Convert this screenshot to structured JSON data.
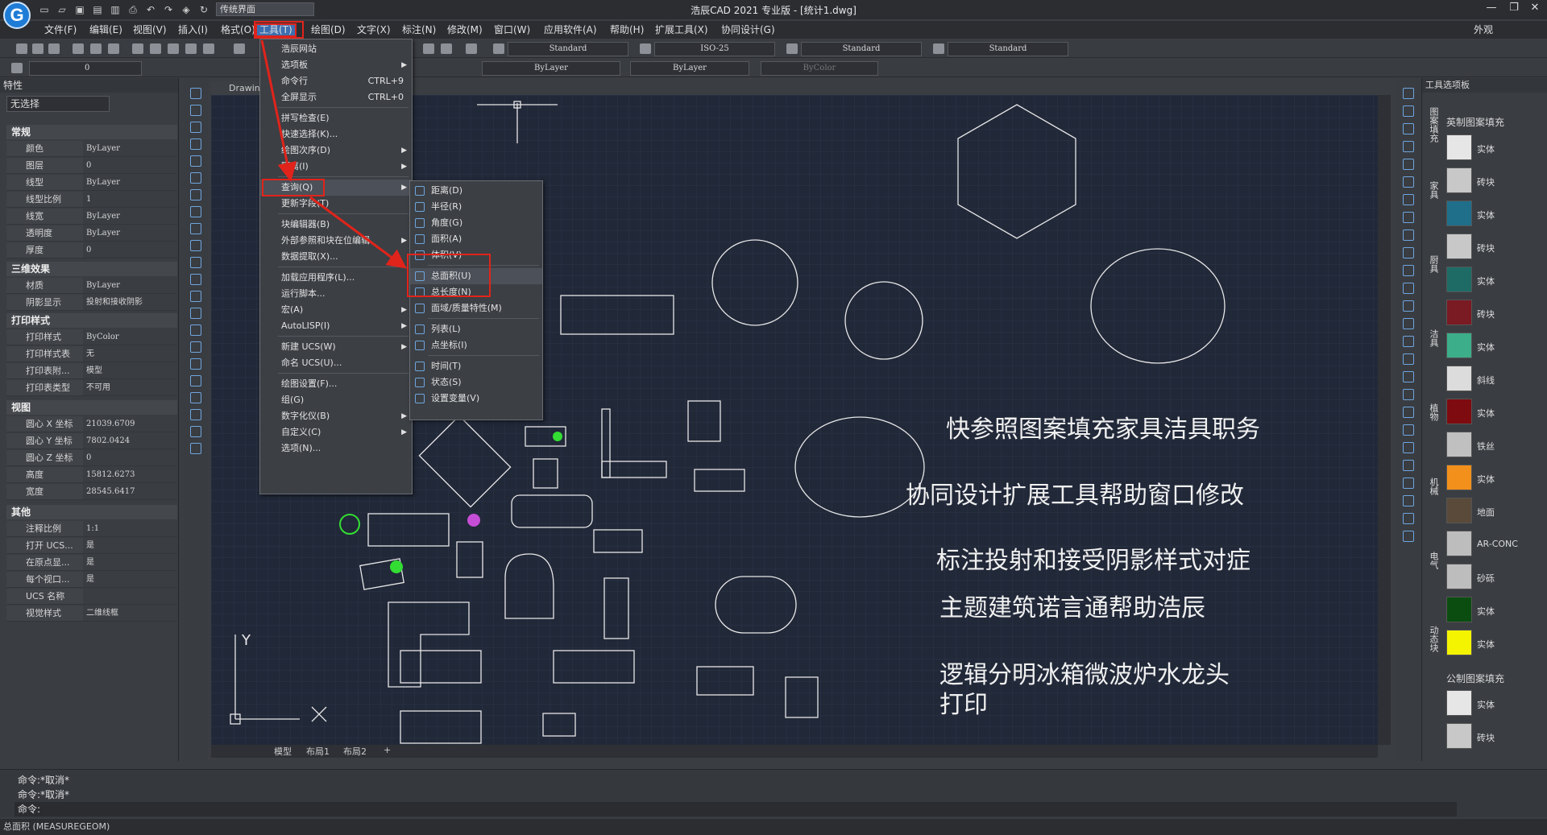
{
  "app_title": "浩辰CAD 2021 专业版 - [统计1.dwg]",
  "workspace": "传统界面",
  "appearance": "外观",
  "menus": [
    "文件(F)",
    "编辑(E)",
    "视图(V)",
    "插入(I)",
    "格式(O)",
    "工具(T)",
    "绘图(D)",
    "文字(X)",
    "标注(N)",
    "修改(M)",
    "窗口(W)",
    "应用软件(A)",
    "帮助(H)",
    "扩展工具(X)",
    "协同设计(G)"
  ],
  "toolbar_dropdowns": {
    "text_style": "Standard",
    "dim_style": "ISO-25",
    "table_style": "Standard",
    "mleader_style": "Standard",
    "layer_value": "0",
    "linetype": "ByLayer",
    "lineweight": "ByLayer",
    "color": "ByColor"
  },
  "properties": {
    "title": "特性",
    "selection": "无选择",
    "sections": {
      "general": {
        "title": "常规",
        "rows": [
          [
            "颜色",
            "ByLayer"
          ],
          [
            "图层",
            "0"
          ],
          [
            "线型",
            "ByLayer"
          ],
          [
            "线型比例",
            "1"
          ],
          [
            "线宽",
            "ByLayer"
          ],
          [
            "透明度",
            "ByLayer"
          ],
          [
            "厚度",
            "0"
          ]
        ]
      },
      "effects": {
        "title": "三维效果",
        "rows": [
          [
            "材质",
            "ByLayer"
          ],
          [
            "阴影显示",
            "投射和接收阴影"
          ]
        ]
      },
      "print": {
        "title": "打印样式",
        "rows": [
          [
            "打印样式",
            "ByColor"
          ],
          [
            "打印样式表",
            "无"
          ],
          [
            "打印表附...",
            "模型"
          ],
          [
            "打印表类型",
            "不可用"
          ]
        ]
      },
      "view": {
        "title": "视图",
        "rows": [
          [
            "圆心 X 坐标",
            "21039.6709"
          ],
          [
            "圆心 Y 坐标",
            "7802.0424"
          ],
          [
            "圆心 Z 坐标",
            "0"
          ],
          [
            "高度",
            "15812.6273"
          ],
          [
            "宽度",
            "28545.6417"
          ]
        ]
      },
      "misc": {
        "title": "其他",
        "rows": [
          [
            "注释比例",
            "1:1"
          ],
          [
            "打开 UCS...",
            "是"
          ],
          [
            "在原点显...",
            "是"
          ],
          [
            "每个视口...",
            "是"
          ],
          [
            "UCS 名称",
            ""
          ],
          [
            "视觉样式",
            "二维线框"
          ]
        ]
      }
    }
  },
  "canvas_tab": "Drawin",
  "layout_tabs": [
    "模型",
    "布局1",
    "布局2",
    "+"
  ],
  "canvas_text": [
    "快参照图案填充家具洁具职务",
    "协同设计扩展工具帮助窗口修改",
    "标注投射和接受阴影样式对症",
    "主题建筑诺言通帮助浩辰",
    "逻辑分明冰箱微波炉水龙头",
    "打印"
  ],
  "axis": {
    "y": "Y",
    "x": "X"
  },
  "tools_menu": [
    {
      "label": "浩辰网站"
    },
    {
      "label": "选项板",
      "arrow": true
    },
    {
      "label": "命令行",
      "shortcut": "CTRL+9"
    },
    {
      "label": "全屏显示",
      "shortcut": "CTRL+0"
    },
    {
      "label": "拼写检查(E)"
    },
    {
      "label": "快速选择(K)..."
    },
    {
      "label": "绘图次序(D)",
      "arrow": true
    },
    {
      "label": "隔离(I)",
      "arrow": true
    },
    {
      "label": "查询(Q)",
      "arrow": true
    },
    {
      "label": "更新字段(T)"
    },
    {
      "label": "块编辑器(B)"
    },
    {
      "label": "外部参照和块在位编辑",
      "arrow": true
    },
    {
      "label": "数据提取(X)..."
    },
    {
      "label": "加载应用程序(L)..."
    },
    {
      "label": "运行脚本..."
    },
    {
      "label": "宏(A)",
      "arrow": true
    },
    {
      "label": "AutoLISP(I)",
      "arrow": true
    },
    {
      "label": "新建 UCS(W)",
      "arrow": true
    },
    {
      "label": "命名 UCS(U)..."
    },
    {
      "label": "绘图设置(F)..."
    },
    {
      "label": "组(G)"
    },
    {
      "label": "数字化仪(B)",
      "arrow": true
    },
    {
      "label": "自定义(C)",
      "arrow": true
    },
    {
      "label": "选项(N)..."
    }
  ],
  "query_menu": [
    {
      "label": "距离(D)"
    },
    {
      "label": "半径(R)"
    },
    {
      "label": "角度(G)"
    },
    {
      "label": "面积(A)"
    },
    {
      "label": "体积(V)"
    },
    {
      "label": "总面积(U)"
    },
    {
      "label": "总长度(N)"
    },
    {
      "label": "面域/质量特性(M)"
    },
    {
      "label": "列表(L)"
    },
    {
      "label": "点坐标(I)"
    },
    {
      "label": "时间(T)"
    },
    {
      "label": "状态(S)"
    },
    {
      "label": "设置变量(V)"
    }
  ],
  "palette": {
    "title": "工具选项板",
    "imperial_title": "英制图案填充",
    "metric_title": "公制图案填充",
    "imperial": [
      [
        "实体",
        "#e6e6e6"
      ],
      [
        "砖块",
        "#c8c8c8"
      ],
      [
        "实体",
        "#1f6f8b"
      ],
      [
        "砖块",
        "#c8c8c8"
      ],
      [
        "实体",
        "#1e6b66"
      ],
      [
        "砖块",
        "#7a1a22"
      ],
      [
        "实体",
        "#3cae8a"
      ],
      [
        "斜线",
        "#dcdcdc"
      ],
      [
        "实体",
        "#7e0b10"
      ],
      [
        "铁丝",
        "#c0c0c0"
      ],
      [
        "实体",
        "#f3901c"
      ],
      [
        "地面",
        "#5a4a3a"
      ],
      [
        "AR-CONC",
        "#bdbdbd"
      ],
      [
        "砂砾",
        "#bdbdbd"
      ],
      [
        "实体",
        "#0b4d10"
      ],
      [
        "实体",
        "#f4f400"
      ]
    ],
    "metric": [
      [
        "实体",
        "#e6e6e6"
      ],
      [
        "砖块",
        "#c8c8c8"
      ]
    ],
    "vtabs": [
      "图案填充",
      "家具",
      "厨具",
      "洁具",
      "植物",
      "机械",
      "电气",
      "动态块"
    ]
  },
  "command_lines": [
    "命令:*取消*",
    "命令:*取消*",
    "命令:"
  ],
  "status_text": "总面积 (MEASUREGEOM)"
}
